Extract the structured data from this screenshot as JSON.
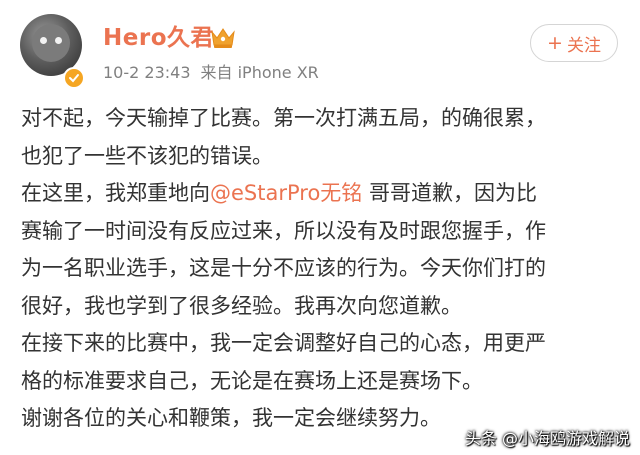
{
  "post": {
    "author": "Hero久君",
    "timestamp": "10-2 23:43",
    "source": "来自 iPhone XR",
    "follow_label": "关注",
    "follow_icon": "plus-icon",
    "lines": {
      "l1": "对不起，今天输掉了比赛。第一次打满五局，的确很累，",
      "l2": "也犯了一些不该犯的错误。",
      "l3a": "在这里，我郑重地向",
      "l3_mention": "@eStarPro无铭",
      "l3b": " 哥哥道歉，因为比",
      "l4": "赛输了一时间没有反应过来，所以没有及时跟您握手，作",
      "l5": "为一名职业选手，这是十分不应该的行为。今天你们打的",
      "l6": "很好，我也学到了很多经验。我再次向您道歉。",
      "l7": "在接下来的比赛中，我一定会调整好自己的心态，用更严",
      "l8": "格的标准要求自己，无论是在赛场上还是赛场下。",
      "l9": "谢谢各位的关心和鞭策，我一定会继续努力。"
    }
  },
  "watermark": "头条 @小海鸥游戏解说",
  "colors": {
    "accent": "#eb7350",
    "verified_badge": "#f5a623",
    "crown": "#f0a22e",
    "text": "#333333",
    "meta": "#808080"
  }
}
